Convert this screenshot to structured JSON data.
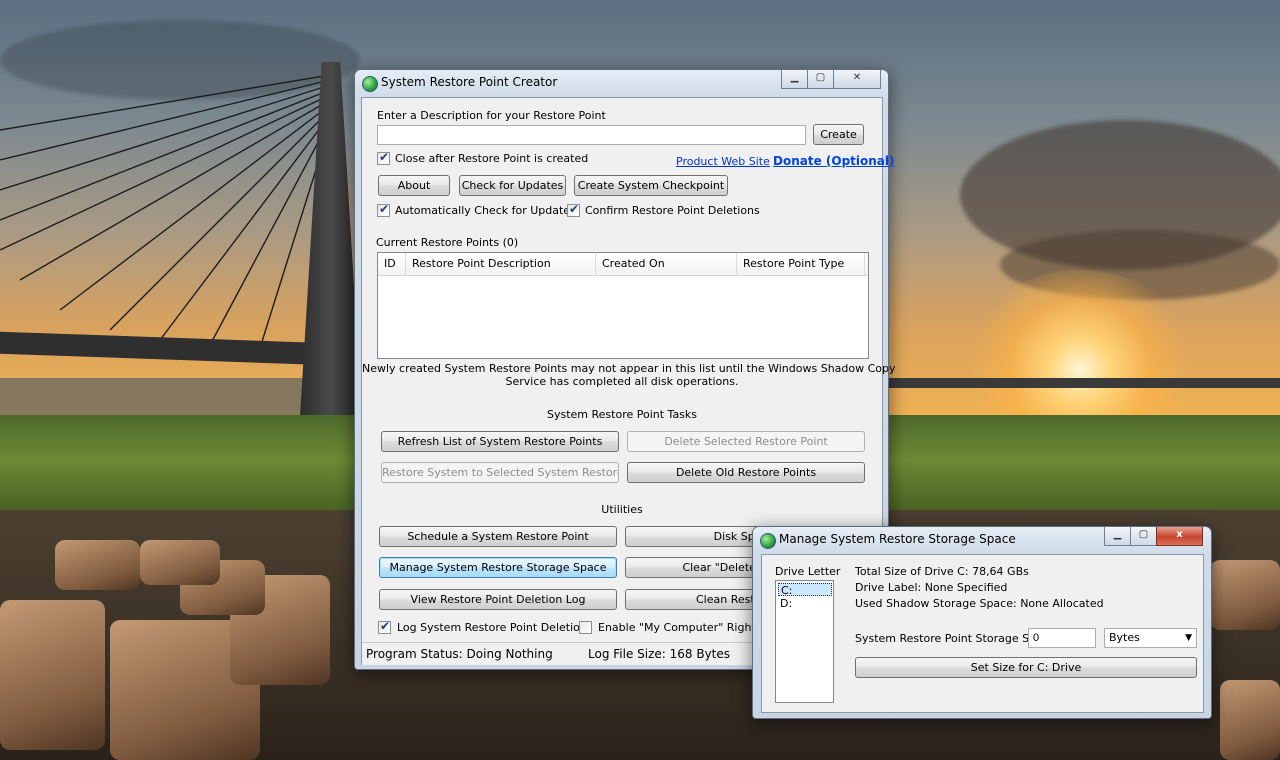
{
  "main_window": {
    "title": "System Restore Point Creator",
    "caption_buttons": {
      "minimize": "▁",
      "maximize": "▢",
      "close": "✕"
    },
    "description_label": "Enter a Description for your Restore Point",
    "description_value": "",
    "create_button": "Create",
    "close_after_checkbox": {
      "label": "Close after Restore Point is created",
      "checked": true
    },
    "product_link": "Product Web Site",
    "donate_link": "Donate (Optional)",
    "about_button": "About",
    "check_updates_button": "Check for Updates",
    "create_checkpoint_button": "Create System Checkpoint",
    "auto_check_checkbox": {
      "label": "Automatically Check for Updates",
      "checked": true
    },
    "confirm_deletions_checkbox": {
      "label": "Confirm Restore Point Deletions",
      "checked": true
    },
    "current_points_label": "Current Restore Points (0)",
    "list_columns": [
      "ID",
      "Restore Point Description",
      "Created On",
      "Restore Point Type"
    ],
    "list_rows": [],
    "shadow_copy_note_line1": "Newly created System Restore Points may not appear in this list until the Windows Shadow Copy",
    "shadow_copy_note_line2": "Service has completed all disk operations.",
    "tasks_header": "System Restore Point Tasks",
    "refresh_button": "Refresh List of System Restore Points",
    "delete_selected_button": "Delete Selected Restore Point",
    "restore_system_button": "Restore System to Selected System Restore",
    "delete_old_button": "Delete Old Restore Points",
    "utilities_header": "Utilities",
    "schedule_button": "Schedule a System Restore Point",
    "disk_space_button": "Disk Space",
    "manage_storage_button": "Manage System Restore Storage Space",
    "clear_delete_old_button": "Clear \"Delete Old Rest",
    "view_log_button": "View Restore Point Deletion Log",
    "clean_restore_button": "Clean Restore Poi",
    "log_deletions_checkbox": {
      "label": "Log System Restore Point Deletions",
      "checked": true
    },
    "enable_my_computer_checkbox": {
      "label": "Enable \"My Computer\" Right-Clic",
      "checked": false
    },
    "status": {
      "program_status": "Program Status:  Doing Nothing",
      "log_file_size": "Log File Size:  168 Bytes"
    }
  },
  "storage_window": {
    "title": "Manage System Restore Storage Space",
    "caption_buttons": {
      "minimize": "▁",
      "maximize": "▢",
      "close": "x"
    },
    "drive_letter_label": "Drive Letter",
    "drives": [
      "C:",
      "D:"
    ],
    "selected_drive": "C:",
    "total_size": "Total Size of Drive C: 78,64 GBs",
    "drive_label": "Drive Label: None Specified",
    "used_shadow": "Used Shadow Storage Space: None Allocated",
    "storage_size_label": "System Restore Point Storage Size:",
    "storage_size_value": "0",
    "unit_selected": "Bytes",
    "set_size_button": "Set Size for C: Drive"
  },
  "icons": {
    "app_icon": "restore-point-globe-icon",
    "dropdown_arrow": "chevron-down-icon",
    "checkmark": "checkmark-icon"
  },
  "colors": {
    "link": "#0033cc",
    "focus_button": "#3c7fb1",
    "selection": "#cce8ff"
  }
}
